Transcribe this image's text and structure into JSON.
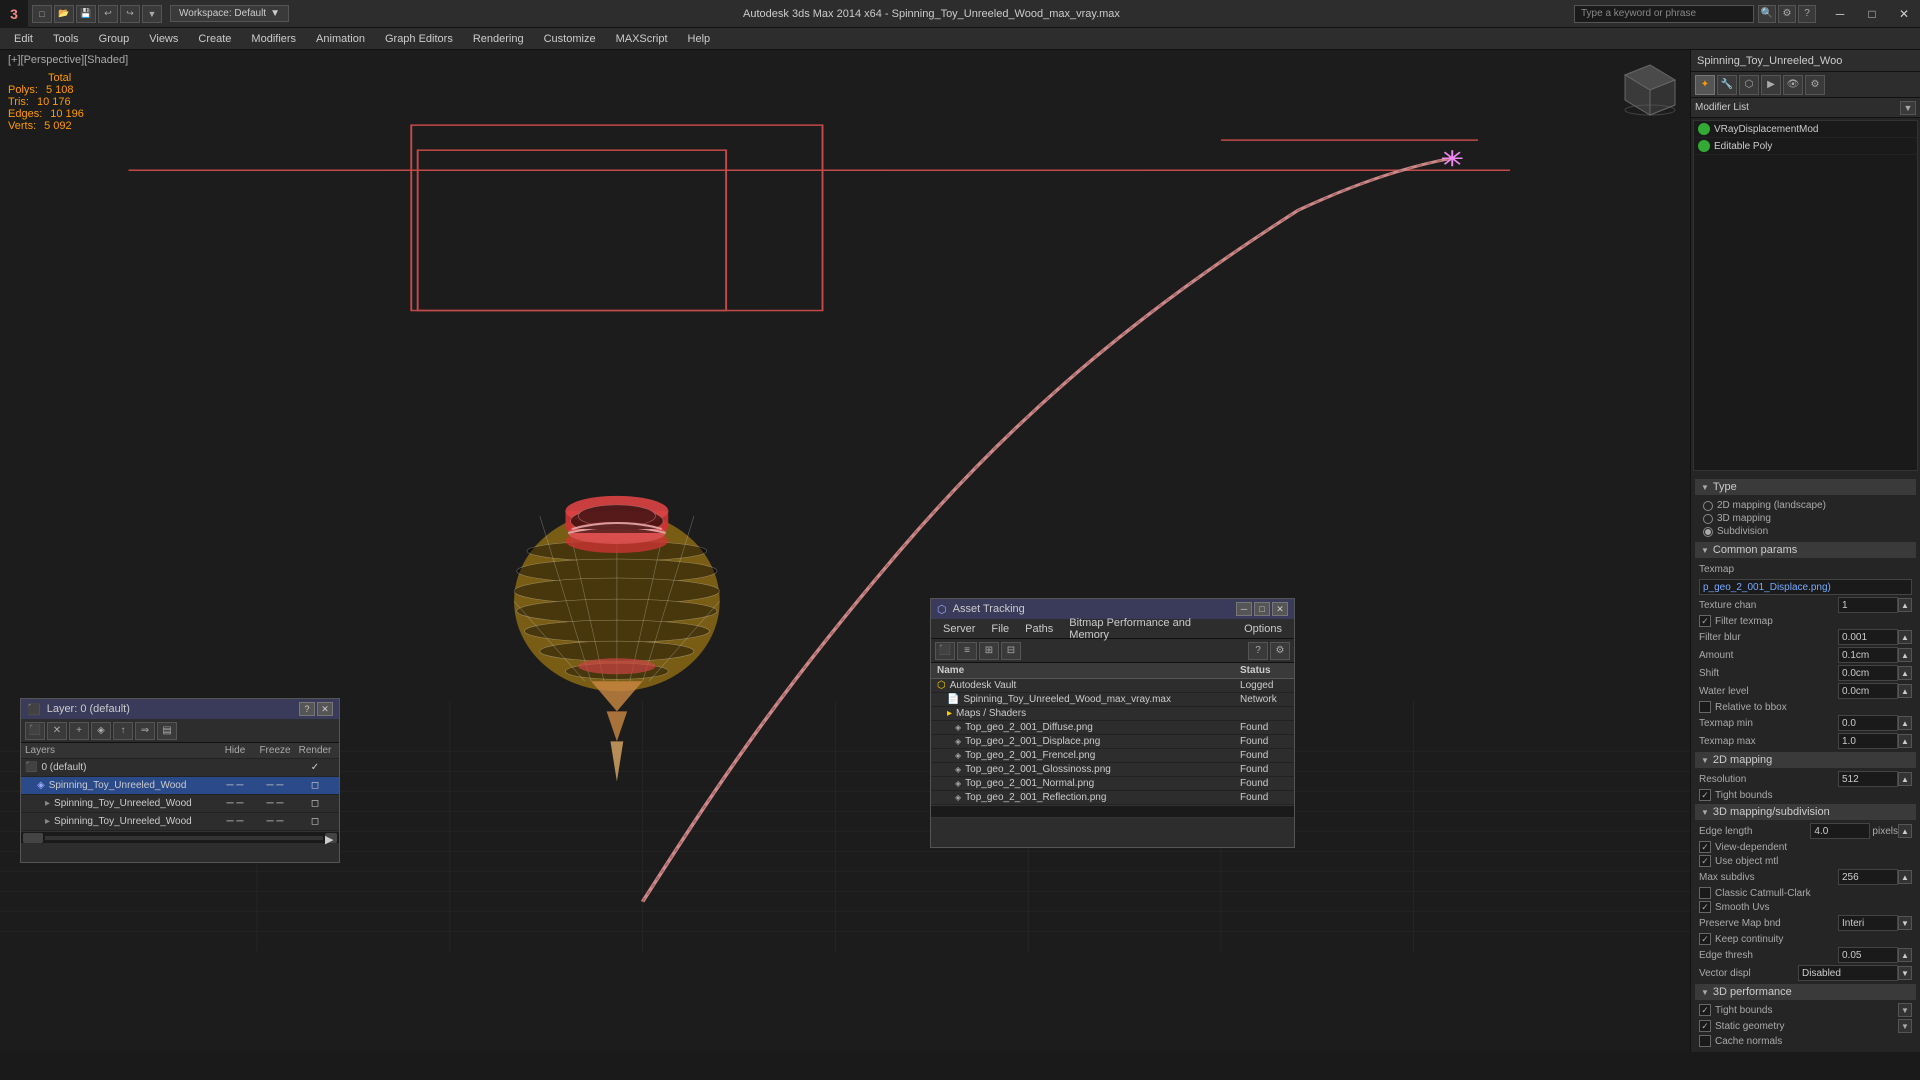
{
  "window": {
    "title": "Autodesk 3ds Max 2014 x64 - Spinning_Toy_Unreeled_Wood_max_vray.max",
    "workspace": "Workspace: Default"
  },
  "menubar": {
    "items": [
      "Edit",
      "Tools",
      "Group",
      "Views",
      "Create",
      "Modifiers",
      "Animation",
      "Graph Editors",
      "Rendering",
      "Customize",
      "MAXScript",
      "Help"
    ]
  },
  "viewport": {
    "label": "[+][Perspective][Shaded]",
    "stats": {
      "polys_label": "Polys:",
      "polys_total_label": "Total",
      "polys_value": "5 108",
      "tris_label": "Tris:",
      "tris_value": "10 176",
      "edges_label": "Edges:",
      "edges_value": "10 196",
      "verts_label": "Verts:",
      "verts_value": "5 092"
    }
  },
  "rightpanel": {
    "object_name": "Spinning_Toy_Unreeled_Woo",
    "modifier_list_label": "Modifier List",
    "modifiers": [
      {
        "name": "VRayDisplacementMod",
        "enabled": true
      },
      {
        "name": "Editable Poly",
        "enabled": true
      }
    ],
    "params": {
      "section_type": "Type",
      "type_options": [
        {
          "label": "2D mapping (landscape)",
          "selected": false
        },
        {
          "label": "3D mapping",
          "selected": false
        },
        {
          "label": "Subdivision",
          "selected": true
        }
      ],
      "section_common": "Common params",
      "texmap_label": "Texmap",
      "texmap_value": "p_geo_2_001_Displace.png)",
      "texture_chan_label": "Texture chan",
      "texture_chan_value": "1",
      "filter_texmap_label": "Filter texmap",
      "filter_blur_label": "Filter blur",
      "filter_blur_value": "0.001",
      "amount_label": "Amount",
      "amount_value": "0.1cm",
      "shift_label": "Shift",
      "shift_value": "0.0cm",
      "water_level_label": "Water level",
      "water_level_value": "0.0cm",
      "relative_bbox_label": "Relative to bbox",
      "texmap_min_label": "Texmap min",
      "texmap_min_value": "0.0",
      "texmap_max_label": "Texmap max",
      "texmap_max_value": "1.0",
      "section_2d": "2D mapping",
      "resolution_label": "Resolution",
      "resolution_value": "512",
      "tight_bounds_label": "Tight bounds",
      "section_3d": "3D mapping/subdivision",
      "edge_length_label": "Edge length",
      "edge_length_value": "4.0",
      "pixels_label": "pixels",
      "view_dependent_label": "View-dependent",
      "use_object_mtl_label": "Use object mtl",
      "max_subdivs_label": "Max subdivs",
      "max_subdivs_value": "256",
      "classic_catmull_label": "Classic Catmull-Clark",
      "smooth_uvs_label": "Smooth Uvs",
      "preserve_map_label": "Preserve Map bnd",
      "preserve_map_value": "Interi",
      "keep_continuity_label": "Keep continuity",
      "edge_thresh_label": "Edge thresh",
      "edge_thresh_value": "0.05",
      "vector_displ_label": "Vector displ",
      "vector_displ_value": "Disabled",
      "section_perf": "3D performance",
      "tight_bounds2_label": "Tight bounds",
      "static_geometry_label": "Static geometry",
      "cache_normals_label": "Cache normals"
    }
  },
  "asset_tracking": {
    "title": "Asset Tracking",
    "menu": [
      "Server",
      "File",
      "Paths",
      "Bitmap Performance and Memory",
      "Options"
    ],
    "columns": [
      "Name",
      "Status"
    ],
    "items": [
      {
        "name": "Autodesk Vault",
        "indent": 0,
        "icon": "vault",
        "status": "Logged",
        "status_class": "status-logged"
      },
      {
        "name": "Spinning_Toy_Unreeled_Wood_max_vray.max",
        "indent": 1,
        "icon": "file",
        "status": "Network",
        "status_class": "status-network"
      },
      {
        "name": "Maps / Shaders",
        "indent": 1,
        "icon": "folder",
        "status": "",
        "status_class": ""
      },
      {
        "name": "Top_geo_2_001_Diffuse.png",
        "indent": 2,
        "icon": "map",
        "status": "Found",
        "status_class": "status-found"
      },
      {
        "name": "Top_geo_2_001_Displace.png",
        "indent": 2,
        "icon": "map",
        "status": "Found",
        "status_class": "status-found"
      },
      {
        "name": "Top_geo_2_001_Frencel.png",
        "indent": 2,
        "icon": "map",
        "status": "Found",
        "status_class": "status-found"
      },
      {
        "name": "Top_geo_2_001_Glossinoss.png",
        "indent": 2,
        "icon": "map",
        "status": "Found",
        "status_class": "status-found"
      },
      {
        "name": "Top_geo_2_001_Normal.png",
        "indent": 2,
        "icon": "map",
        "status": "Found",
        "status_class": "status-found"
      },
      {
        "name": "Top_geo_2_001_Reflection.png",
        "indent": 2,
        "icon": "map",
        "status": "Found",
        "status_class": "status-found"
      }
    ]
  },
  "layers": {
    "title": "Layer: 0 (default)",
    "columns": {
      "layers": "Layers",
      "hide": "Hide",
      "freeze": "Freeze",
      "render": "Render"
    },
    "items": [
      {
        "name": "0 (default)",
        "indent": 0,
        "active": false,
        "hide": false,
        "freeze": false,
        "render": true
      },
      {
        "name": "Spinning_Toy_Unreeled_Wood",
        "indent": 1,
        "active": true,
        "hide": false,
        "freeze": false,
        "render": true
      },
      {
        "name": "Spinning_Toy_Unreeled_Wood",
        "indent": 2,
        "active": false,
        "hide": false,
        "freeze": false,
        "render": true
      },
      {
        "name": "Spinning_Toy_Unreeled_Wood",
        "indent": 2,
        "active": false,
        "hide": false,
        "freeze": false,
        "render": true
      }
    ]
  },
  "icons": {
    "close": "✕",
    "minimize": "─",
    "maximize": "□",
    "arrow_down": "▼",
    "arrow_right": "▶",
    "check": "✓",
    "folder": "📁",
    "file": "📄"
  }
}
